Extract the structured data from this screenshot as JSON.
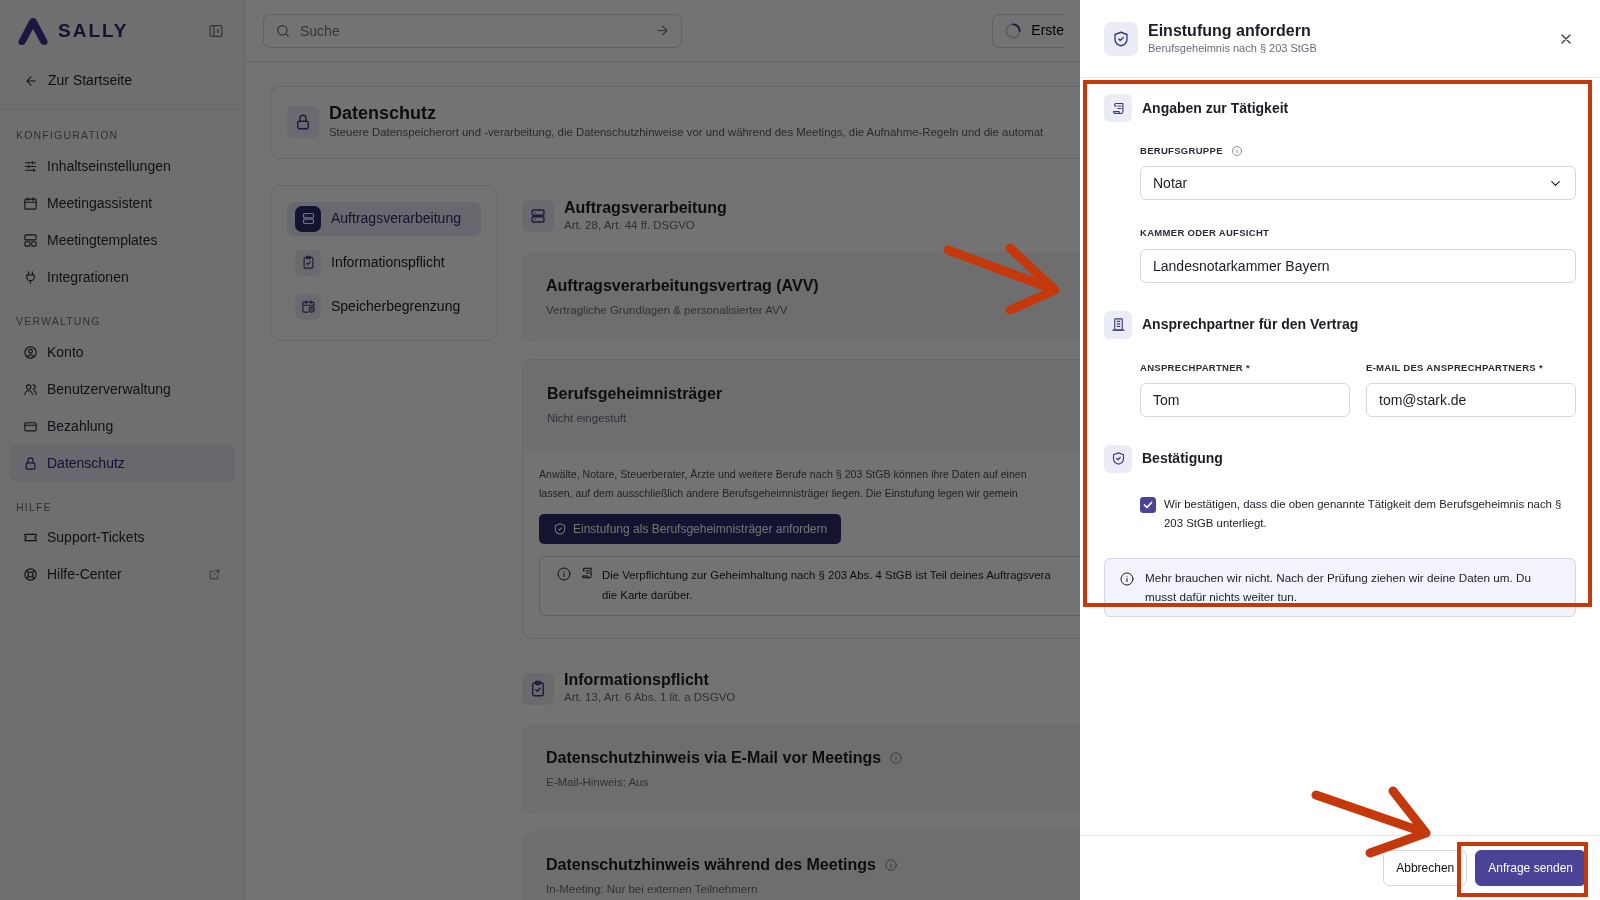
{
  "sidebar": {
    "logo": "SALLY",
    "back_link": "Zur Startseite",
    "groups": [
      {
        "title": "KONFIGURATION",
        "items": [
          {
            "label": "Inhaltseinstellungen",
            "selected": false,
            "external": false
          },
          {
            "label": "Meetingassistent",
            "selected": false,
            "external": false
          },
          {
            "label": "Meetingtemplates",
            "selected": false,
            "external": false
          },
          {
            "label": "Integrationen",
            "selected": false,
            "external": false
          }
        ]
      },
      {
        "title": "VERWALTUNG",
        "items": [
          {
            "label": "Konto",
            "selected": false,
            "external": false
          },
          {
            "label": "Benutzerverwaltung",
            "selected": false,
            "external": false
          },
          {
            "label": "Bezahlung",
            "selected": false,
            "external": false
          },
          {
            "label": "Datenschutz",
            "selected": true,
            "external": false
          }
        ]
      },
      {
        "title": "HILFE",
        "items": [
          {
            "label": "Support-Tickets",
            "selected": false,
            "external": false
          },
          {
            "label": "Hilfe-Center",
            "selected": false,
            "external": true
          }
        ]
      }
    ]
  },
  "topbar": {
    "search": {
      "placeholder": "Suche"
    },
    "button": {
      "label": "Erste"
    }
  },
  "page_header": {
    "title": "Datenschutz",
    "description": "Steuere Datenspeicherort und -verarbeitung, die Datenschutzhinweise vor und während des Meetings, die Aufnahme-Regeln und die automat"
  },
  "subnav": [
    {
      "label": "Auftragsverarbeitung",
      "selected": true
    },
    {
      "label": "Informationspflicht",
      "selected": false
    },
    {
      "label": "Speicherbegrenzung",
      "selected": false
    }
  ],
  "sections": [
    {
      "title": "Auftragsverarbeitung",
      "subtitle": "Art. 28, Art. 44 ff. DSGVO",
      "cards": [
        {
          "kind": "simple",
          "title": "Auftragsverarbeitungsvertrag (AVV)",
          "subtitle": "Vertragliche Grundlagen & personalisierter AVV",
          "info": false
        },
        {
          "kind": "expanded",
          "title": "Berufsgeheimnisträger",
          "subtitle": "Nicht eingestuft",
          "text_lines": [
            "Anwälte, Notare, Steuerberater, Ärzte und weitere Berufe nach § 203 StGB können ihre Daten auf einen",
            "lassen, auf dem ausschließlich andere Berufsgeheimnisträger liegen. Die Einstufung legen wir gemein"
          ],
          "button": "Einstufung als Berufsgeheimnisträger anfordern",
          "info_lines": [
            "Die Verpflichtung zur Geheimhaltung nach § 203 Abs. 4 StGB ist Teil deines Auftragsvera",
            "die Karte darüber."
          ]
        }
      ]
    },
    {
      "title": "Informationspflicht",
      "subtitle": "Art. 13, Art. 6 Abs. 1 lit. a DSGVO",
      "cards": [
        {
          "kind": "simple",
          "title": "Datenschutzhinweis via E-Mail vor Meetings",
          "subtitle": "E-Mail-Hinweis: Aus",
          "info": true
        },
        {
          "kind": "simple",
          "title": "Datenschutzhinweis während des Meetings",
          "subtitle": "In-Meeting: Nur bei externen Teilnehmern",
          "info": true
        }
      ]
    }
  ],
  "dialog": {
    "title": "Einstufung anfordern",
    "subtitle": "Berufsgeheimnis nach § 203 StGB",
    "sections": [
      {
        "title": "Angaben zur Tätigkeit",
        "field_rows": [
          [
            {
              "kind": "select",
              "label": "BERUFSGRUPPE",
              "info": true,
              "value": "Notar"
            }
          ],
          [
            {
              "kind": "text",
              "label": "KAMMER ODER AUFSICHT",
              "info": false,
              "value": "Landesnotarkammer Bayern"
            }
          ]
        ]
      },
      {
        "title": "Ansprechpartner für den Vertrag",
        "field_rows": [
          [
            {
              "kind": "text",
              "label": "ANSPRECHPARTNER *",
              "info": false,
              "value": "Tom"
            },
            {
              "kind": "text",
              "label": "E-MAIL DES ANSPRECHPARTNERS *",
              "info": false,
              "value": "tom@stark.de"
            }
          ]
        ]
      },
      {
        "title": "Bestätigung",
        "checkbox": {
          "label": "Wir bestätigen, dass die oben genannte Tätigkeit dem Berufsgeheimnis nach § 203 StGB unterliegt.",
          "checked": true
        }
      }
    ],
    "note": "Mehr brauchen wir nicht. Nach der Prüfung ziehen wir deine Daten um. Du musst dafür nichts weiter tun.",
    "buttons": [
      {
        "kind": "secondary",
        "label": "Abbrechen"
      },
      {
        "kind": "primary",
        "label": "Anfrage senden"
      }
    ]
  }
}
